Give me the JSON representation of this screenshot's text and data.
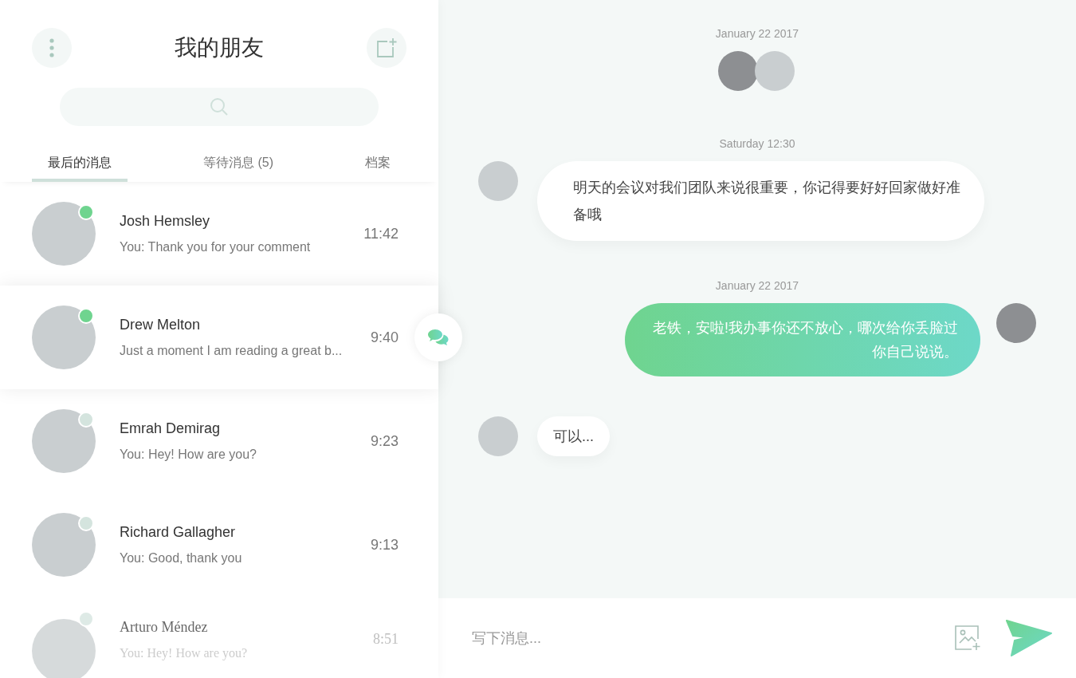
{
  "sidebar": {
    "title": "我的朋友",
    "tabs": [
      {
        "label": "最后的消息",
        "selected": true
      },
      {
        "label": "等待消息 (5)",
        "selected": false
      },
      {
        "label": "档案",
        "selected": false
      }
    ],
    "contacts": [
      {
        "name": "Josh Hemsley",
        "preview": "You: Thank you for your comment",
        "time": "11:42",
        "online": true,
        "selected": false,
        "faded": false
      },
      {
        "name": "Drew Melton",
        "preview": "Just a moment I am reading a great b...",
        "time": "9:40",
        "online": true,
        "selected": true,
        "faded": false
      },
      {
        "name": "Emrah Demirag",
        "preview": "You: Hey! How are you?",
        "time": "9:23",
        "online": false,
        "selected": false,
        "faded": false
      },
      {
        "name": "Richard Gallagher",
        "preview": "You: Good, thank you",
        "time": "9:13",
        "online": false,
        "selected": false,
        "faded": false
      },
      {
        "name": "Arturo Méndez",
        "preview": "You: Hey! How are you?",
        "time": "8:51",
        "online": false,
        "selected": false,
        "faded": true
      }
    ]
  },
  "chat": {
    "messages": [
      {
        "kind": "date",
        "text": "January 22 2017"
      },
      {
        "kind": "participants"
      },
      {
        "kind": "date",
        "text": "Saturday 12:30"
      },
      {
        "kind": "incoming",
        "text": "明天的会议对我们团队来说很重要，你记得要好好回家做好准备哦"
      },
      {
        "kind": "date",
        "text": "January 22 2017"
      },
      {
        "kind": "outgoing",
        "text": "老铁，安啦!我办事你还不放心，哪次给你丢脸过你自己说说。"
      },
      {
        "kind": "incoming",
        "text": "可以..."
      }
    ],
    "composer": {
      "placeholder": "写下消息..."
    }
  }
}
